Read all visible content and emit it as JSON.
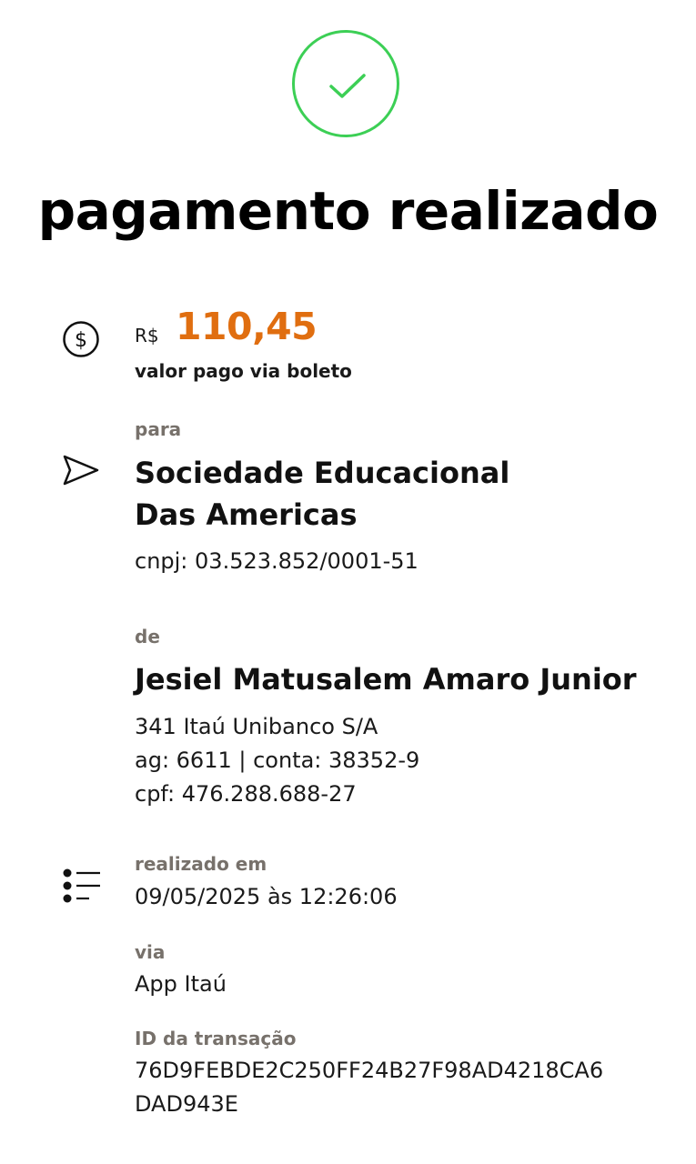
{
  "header": {
    "title": "pagamento realizado",
    "success_icon": "check-circle-icon",
    "success_color": "#3ccf55"
  },
  "amount": {
    "currency": "R$",
    "value": "110,45",
    "caption": "valor pago via boleto",
    "icon": "dollar-circle-icon",
    "accent_color": "#e06e10"
  },
  "recipient": {
    "label": "para",
    "name_line1": "Sociedade Educacional",
    "name_line2": "Das Americas",
    "document": "cnpj: 03.523.852/0001-51",
    "icon": "send-icon"
  },
  "payer": {
    "label": "de",
    "name": "Jesiel Matusalem Amaro Junior",
    "bank": "341 Itaú Unibanco S/A",
    "account": "ag: 6611 | conta: 38352-9",
    "document": "cpf: 476.288.688-27"
  },
  "details": {
    "icon": "list-icon",
    "date_label": "realizado em",
    "date_value": "09/05/2025 às 12:26:06",
    "channel_label": "via",
    "channel_value": "App Itaú",
    "transaction_label": "ID da transação",
    "transaction_line1": "76D9FEBDE2C250FF24B27F98AD4218CA6",
    "transaction_line2": "DAD943E"
  }
}
